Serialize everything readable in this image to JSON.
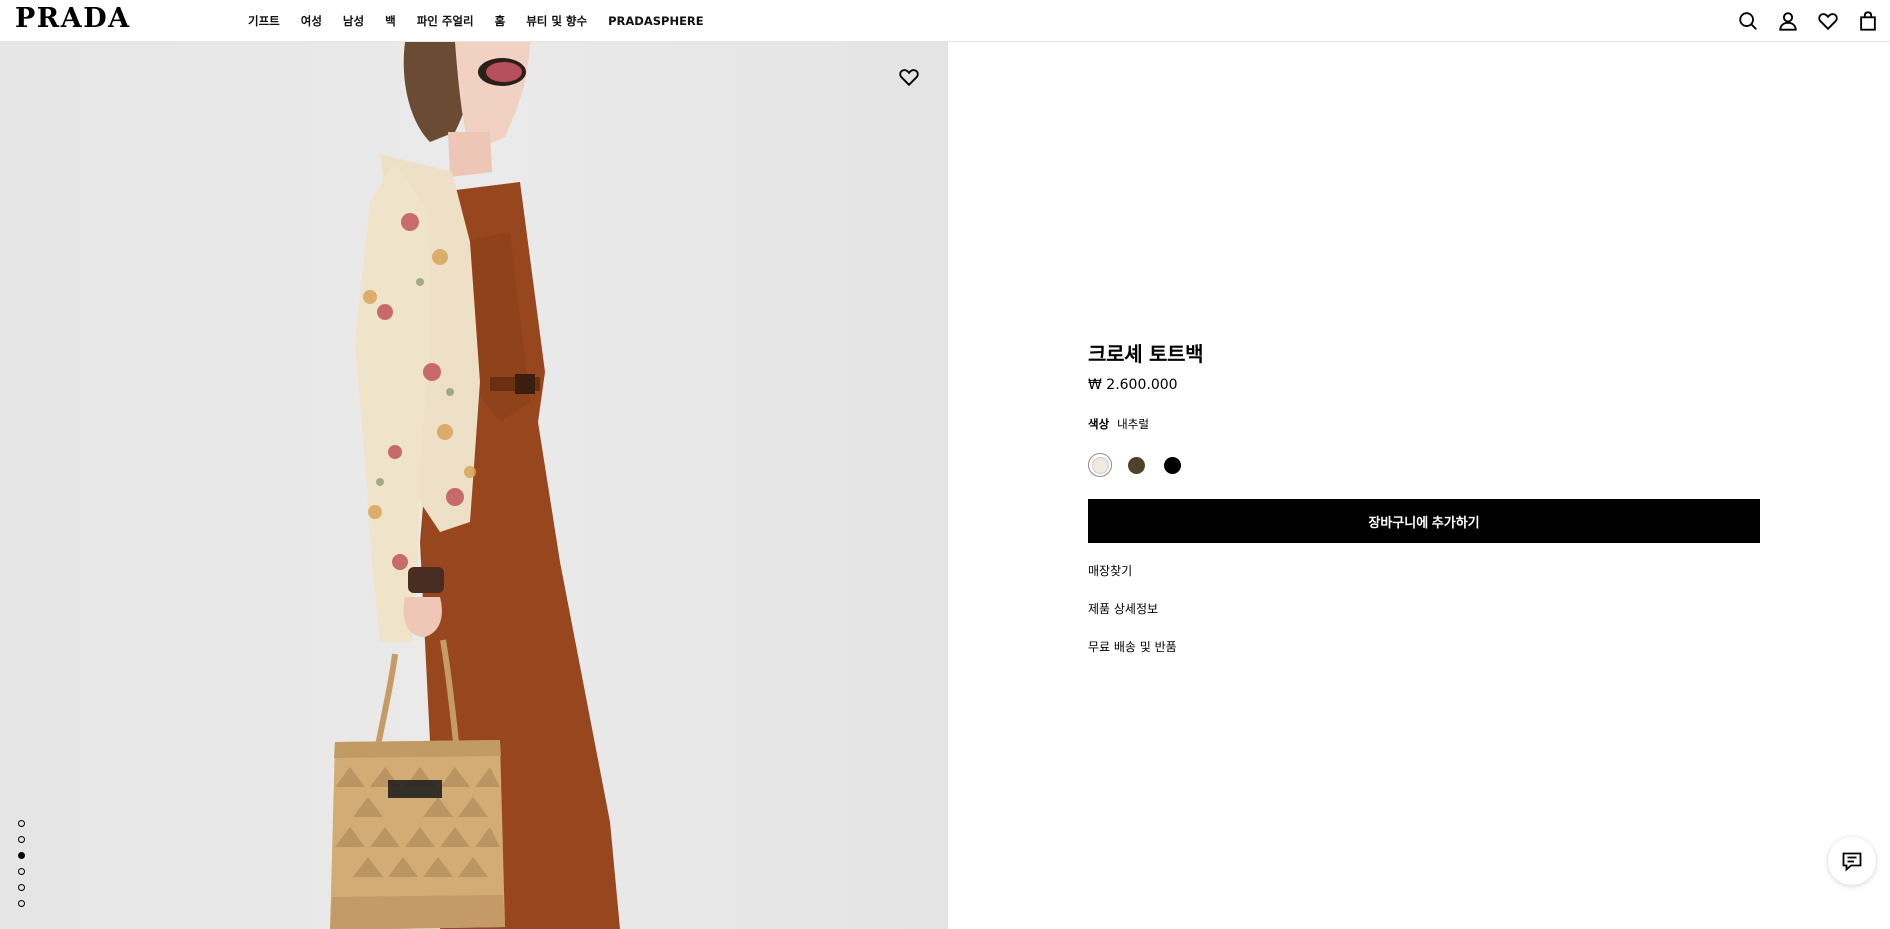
{
  "header": {
    "logo": "PRADA",
    "nav": [
      "기프트",
      "여성",
      "남성",
      "백",
      "파인 주얼리",
      "홈",
      "뷰티 및 향수",
      "PRADASPHERE"
    ],
    "icons": [
      "search-icon",
      "account-icon",
      "wishlist-icon",
      "bag-icon"
    ]
  },
  "gallery": {
    "dot_count": 6,
    "active_dot": 3,
    "background": "#e8e8e8"
  },
  "product": {
    "title": "크로셰 토트백",
    "price": "₩ 2.600.000",
    "color_label": "색상",
    "color_value": "내추럴",
    "swatches": [
      {
        "name": "natural",
        "color": "#efe9e0",
        "selected": true
      },
      {
        "name": "brown",
        "color": "#4e4329",
        "selected": false
      },
      {
        "name": "black",
        "color": "#000000",
        "selected": false
      }
    ],
    "add_to_cart": "장바구니에 추가하기",
    "links": [
      "매장찾기",
      "제품 상세정보",
      "무료 배송 및 반품"
    ]
  },
  "chat": {
    "icon": "chat-icon"
  }
}
